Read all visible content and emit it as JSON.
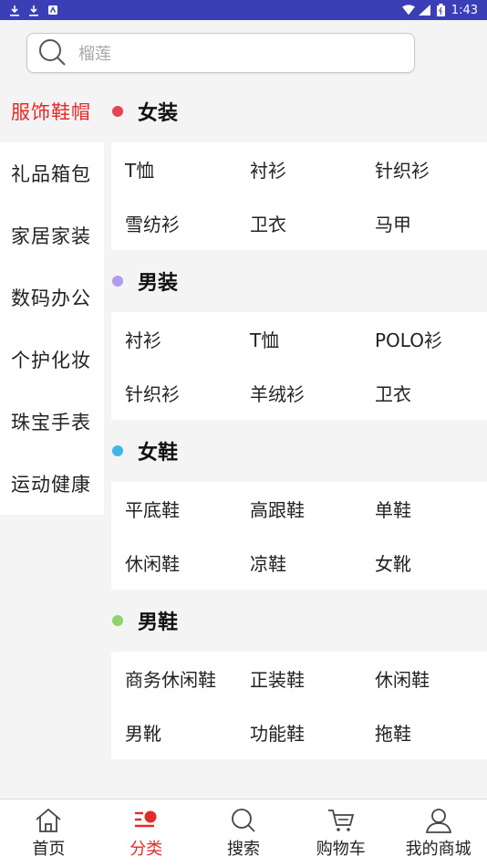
{
  "status_bar": {
    "time": "1:43"
  },
  "search": {
    "placeholder": "榴莲"
  },
  "sidebar": {
    "items": [
      {
        "label": "服饰鞋帽"
      },
      {
        "label": "礼品箱包"
      },
      {
        "label": "家居家装"
      },
      {
        "label": "数码办公"
      },
      {
        "label": "个护化妆"
      },
      {
        "label": "珠宝手表"
      },
      {
        "label": "运动健康"
      }
    ]
  },
  "sections": [
    {
      "title": "女装",
      "dot_color": "#e8425a",
      "items": [
        "T恤",
        "衬衫",
        "针织衫",
        "雪纺衫",
        "卫衣",
        "马甲"
      ]
    },
    {
      "title": "男装",
      "dot_color": "#b49af0",
      "items": [
        "衬衫",
        "T恤",
        "POLO衫",
        "针织衫",
        "羊绒衫",
        "卫衣"
      ]
    },
    {
      "title": "女鞋",
      "dot_color": "#3fb7e6",
      "items": [
        "平底鞋",
        "高跟鞋",
        "单鞋",
        "休闲鞋",
        "凉鞋",
        "女靴"
      ]
    },
    {
      "title": "男鞋",
      "dot_color": "#8fd46a",
      "items": [
        "商务休闲鞋",
        "正装鞋",
        "休闲鞋",
        "男靴",
        "功能鞋",
        "拖鞋"
      ]
    }
  ],
  "bottom_nav": {
    "items": [
      {
        "label": "首页",
        "icon": "home-icon"
      },
      {
        "label": "分类",
        "icon": "category-icon"
      },
      {
        "label": "搜索",
        "icon": "search-icon"
      },
      {
        "label": "购物车",
        "icon": "cart-icon"
      },
      {
        "label": "我的商城",
        "icon": "user-icon"
      }
    ]
  },
  "colors": {
    "accent": "#e52a2a",
    "status_bar": "#3a3fb5"
  }
}
